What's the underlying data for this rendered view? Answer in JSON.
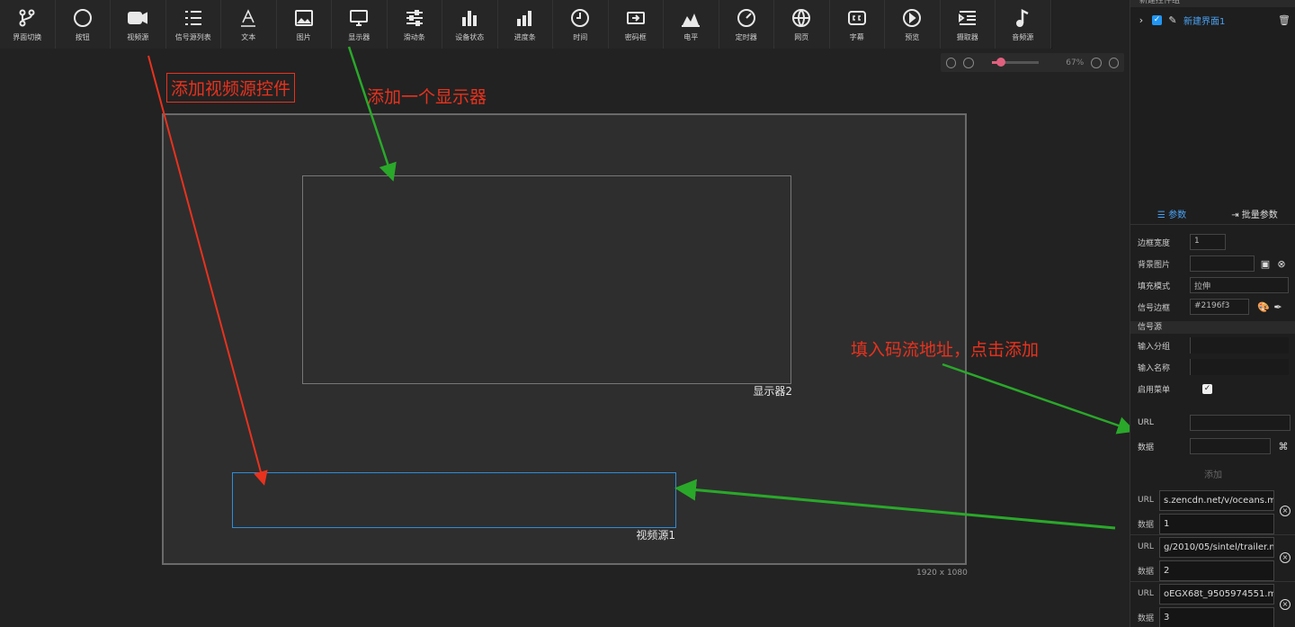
{
  "toolbar": {
    "items": [
      {
        "label": "界面切换",
        "icon": "switch-icon"
      },
      {
        "label": "按钮",
        "icon": "circle-icon"
      },
      {
        "label": "视频源",
        "icon": "video-camera-icon"
      },
      {
        "label": "信号源列表",
        "icon": "list-icon"
      },
      {
        "label": "文本",
        "icon": "text-icon"
      },
      {
        "label": "图片",
        "icon": "image-icon"
      },
      {
        "label": "显示器",
        "icon": "monitor-icon"
      },
      {
        "label": "滑动条",
        "icon": "sliders-icon"
      },
      {
        "label": "设备状态",
        "icon": "bar-chart-icon"
      },
      {
        "label": "进度条",
        "icon": "progress-icon"
      },
      {
        "label": "时间",
        "icon": "clock-icon"
      },
      {
        "label": "密码框",
        "icon": "password-icon"
      },
      {
        "label": "电平",
        "icon": "area-chart-icon"
      },
      {
        "label": "定时器",
        "icon": "timer-icon"
      },
      {
        "label": "网页",
        "icon": "globe-icon"
      },
      {
        "label": "字幕",
        "icon": "caption-icon"
      },
      {
        "label": "预览",
        "icon": "play-icon"
      },
      {
        "label": "摄取器",
        "icon": "menu-indent-icon"
      },
      {
        "label": "音频源",
        "icon": "music-note-icon"
      }
    ]
  },
  "zoom": {
    "percent": "67%",
    "level": 0.2
  },
  "canvas": {
    "display_label": "显示器2",
    "video_label": "视频源1",
    "resolution": "1920 x 1080"
  },
  "annotations": {
    "add_video": "添加视频源控件",
    "add_display": "添加一个显示器",
    "fill_stream": "填入码流地址，点击添加"
  },
  "panel": {
    "header": "新建控件组",
    "tree_item": "新建界面1",
    "tabs": {
      "params": "参数",
      "batch": "批量参数"
    },
    "props": {
      "border_width_label": "边框宽度",
      "border_width_value": "1",
      "bg_image_label": "背景图片",
      "fill_mode_label": "填充模式",
      "fill_mode_value": "拉伸",
      "signal_border_label": "信号边框",
      "signal_border_value": "#2196f3"
    },
    "signal_section": "信号源",
    "input_group_label": "输入分组",
    "input_name_label": "输入名称",
    "enable_menu_label": "启用菜单",
    "url_label": "URL",
    "data_label": "数据",
    "add_label": "添加",
    "entries": [
      {
        "url": "s.zencdn.net/v/oceans.mp4",
        "data": "1"
      },
      {
        "url": "g/2010/05/sintel/trailer.mp4",
        "data": "2"
      },
      {
        "url": "oEGX68t_9505974551.mp4",
        "data": "3"
      }
    ]
  }
}
